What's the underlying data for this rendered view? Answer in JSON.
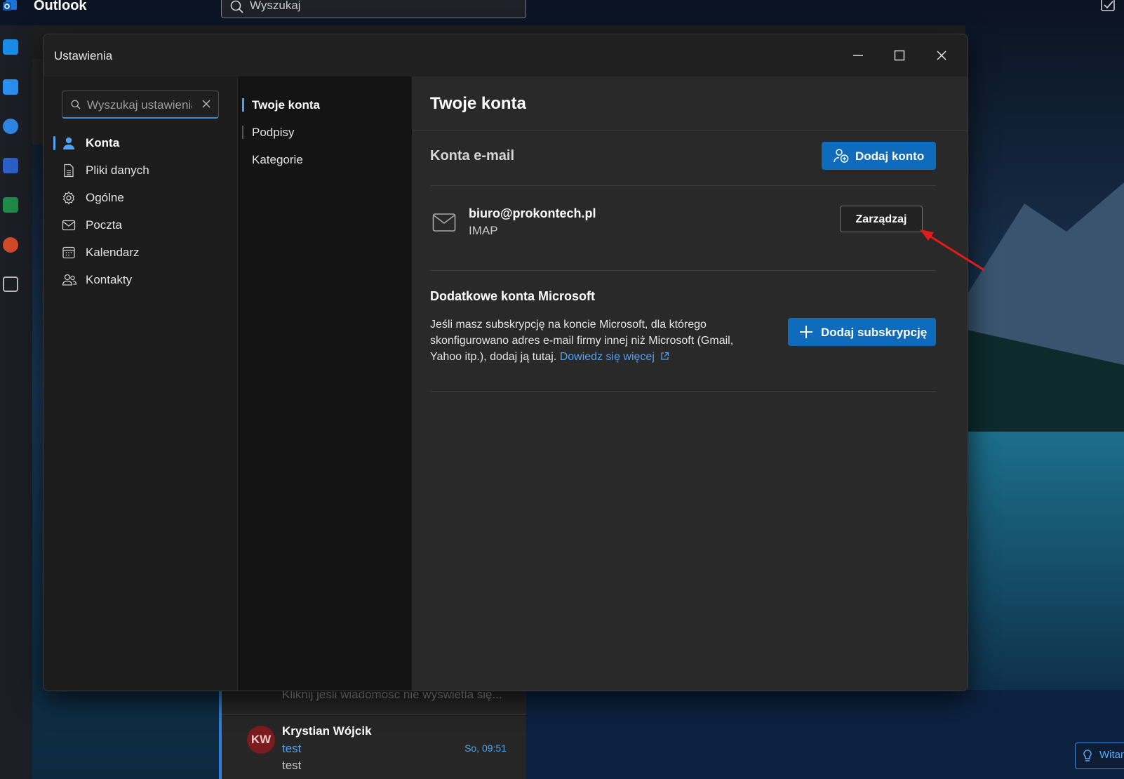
{
  "topbar": {
    "app_title": "Outlook",
    "search_placeholder": "Wyszukaj"
  },
  "dialog": {
    "title": "Ustawienia",
    "search_placeholder": "Wyszukaj ustawienia",
    "nav": [
      {
        "label": "Konta",
        "icon": "person-icon",
        "active": true
      },
      {
        "label": "Pliki danych",
        "icon": "document-icon",
        "active": false
      },
      {
        "label": "Ogólne",
        "icon": "gear-icon",
        "active": false
      },
      {
        "label": "Poczta",
        "icon": "mail-icon",
        "active": false
      },
      {
        "label": "Kalendarz",
        "icon": "calendar-icon",
        "active": false
      },
      {
        "label": "Kontakty",
        "icon": "people-icon",
        "active": false
      }
    ],
    "subnav": [
      {
        "label": "Twoje konta",
        "active": true
      },
      {
        "label": "Podpisy",
        "active": false
      },
      {
        "label": "Kategorie",
        "active": false
      }
    ],
    "content": {
      "title": "Twoje konta",
      "email_section": "Konta e-mail",
      "add_account_label": "Dodaj konto",
      "account_email": "biuro@prokontech.pl",
      "account_type": "IMAP",
      "manage_label": "Zarządzaj",
      "ms_title": "Dodatkowe konta Microsoft",
      "ms_desc": "Jeśli masz subskrypcję na koncie Microsoft, dla którego skonfigurowano adres e-mail firmy innej niż Microsoft (Gmail, Yahoo itp.), dodaj ją tutaj.",
      "ms_link": "Dowiedz się więcej",
      "add_subscription_label": "Dodaj subskrypcję"
    }
  },
  "message_list": {
    "hint": "Kliknij jeśli wiadomość nie wyświetla się...",
    "avatar_initials": "KW",
    "sender": "Krystian Wójcik",
    "subject": "test",
    "time": "So, 09:51",
    "preview": "test"
  },
  "witam_label": "Witam",
  "colors": {
    "accent": "#0f6cbd",
    "link": "#4ea1f3",
    "annotation_arrow": "#e21b1b"
  }
}
